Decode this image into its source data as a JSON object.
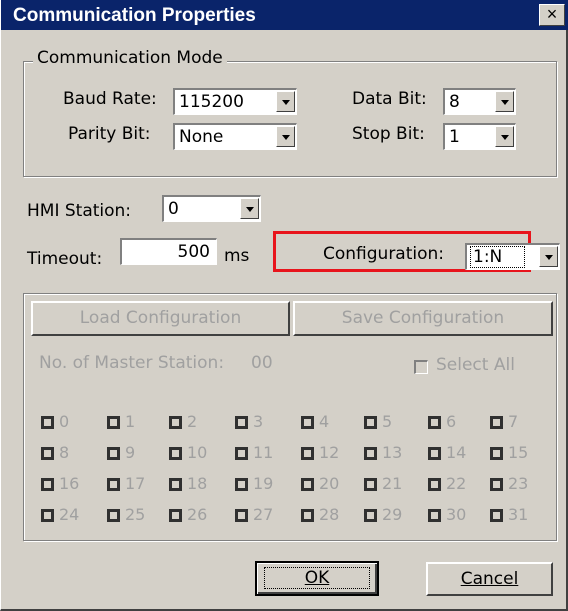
{
  "title": "Communication Properties",
  "close_glyph": "×",
  "comm_mode": {
    "legend": "Communication Mode",
    "baud_label": "Baud Rate:",
    "baud_value": "115200",
    "data_bit_label": "Data Bit:",
    "data_bit_value": "8",
    "parity_label": "Parity Bit:",
    "parity_value": "None",
    "stop_bit_label": "Stop Bit:",
    "stop_bit_value": "1"
  },
  "hmi_station_label": "HMI Station:",
  "hmi_station_value": "0",
  "timeout_label": "Timeout:",
  "timeout_value": "500",
  "timeout_unit": "ms",
  "configuration_label": "Configuration:",
  "configuration_value": "1:N",
  "load_config_label": "Load Configuration",
  "save_config_label": "Save Configuration",
  "master_station_label": "No. of Master Station:",
  "master_station_value": "00",
  "select_all_label": "Select All",
  "stations": [
    "0",
    "1",
    "2",
    "3",
    "4",
    "5",
    "6",
    "7",
    "8",
    "9",
    "10",
    "11",
    "12",
    "13",
    "14",
    "15",
    "16",
    "17",
    "18",
    "19",
    "20",
    "21",
    "22",
    "23",
    "24",
    "25",
    "26",
    "27",
    "28",
    "29",
    "30",
    "31"
  ],
  "ok_label": "OK",
  "cancel_label": "Cancel",
  "colors": {
    "title_bar": "#0a246a",
    "highlight": "#e8141c",
    "face": "#d4d0c8"
  }
}
